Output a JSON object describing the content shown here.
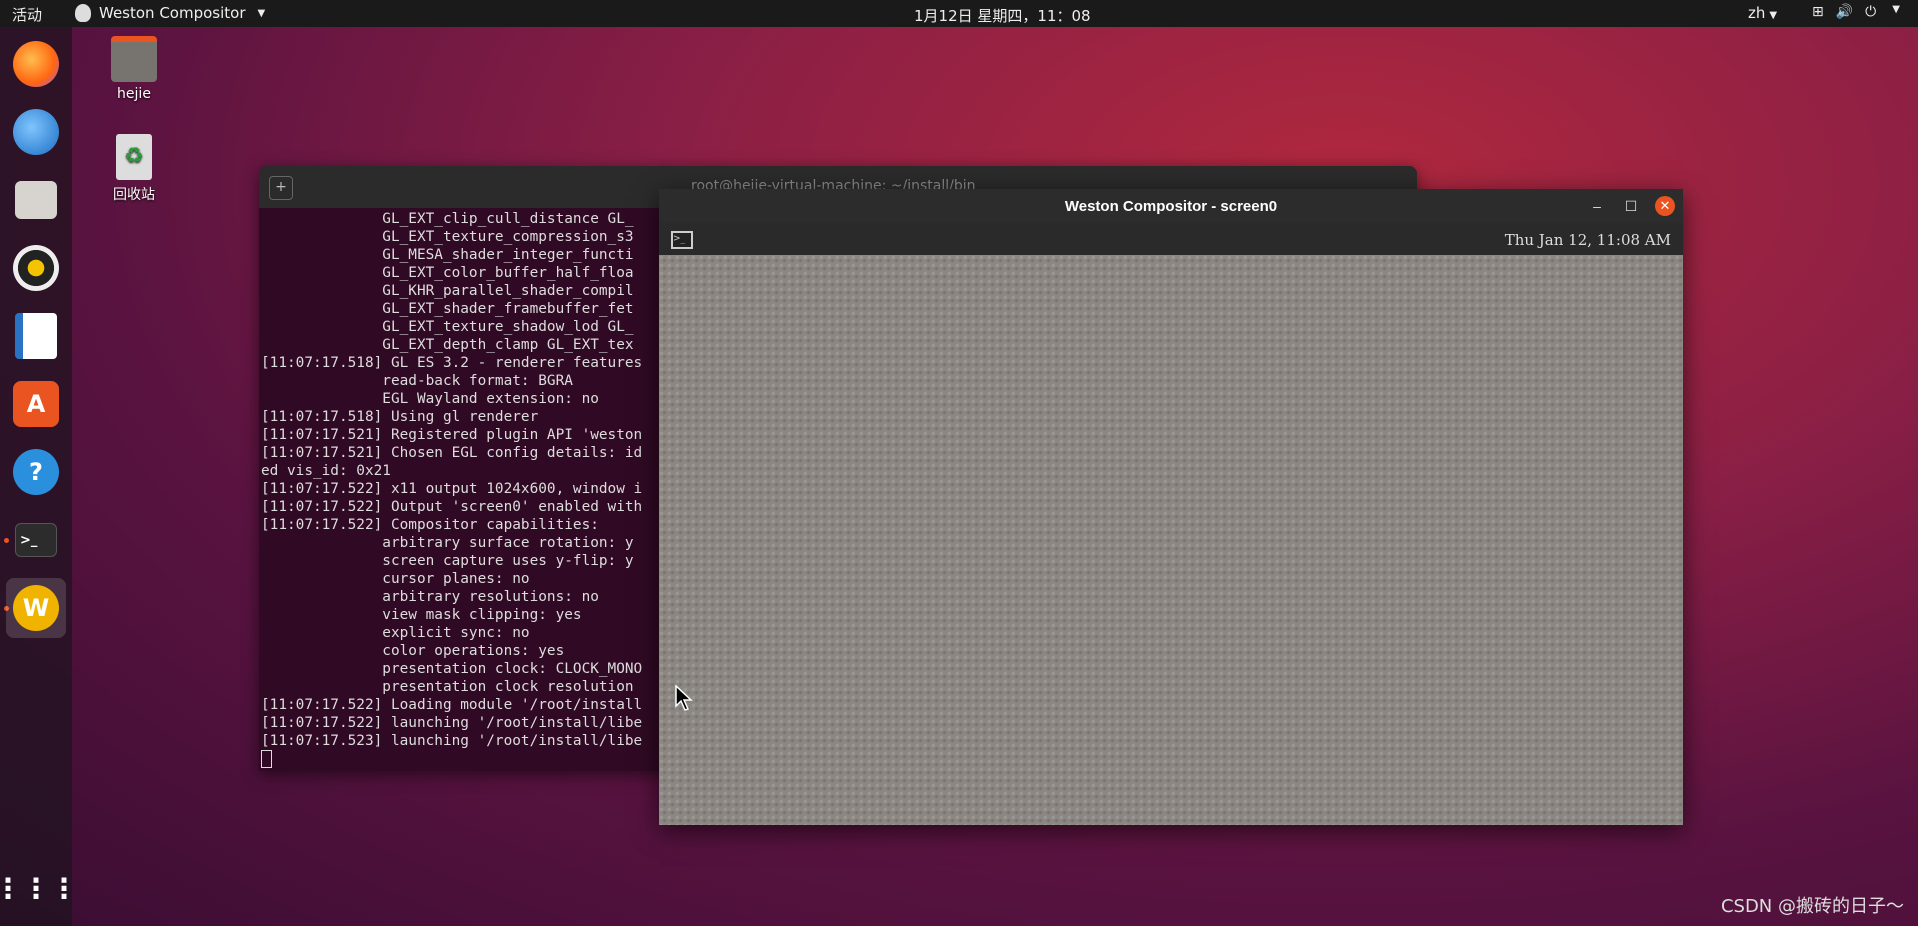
{
  "topbar": {
    "activities": "活动",
    "app_name": "Weston Compositor",
    "clock": "1月12日 星期四，11：08",
    "lang": "zh"
  },
  "desktop": {
    "home_label": "hejie",
    "trash_label": "回收站"
  },
  "terminal": {
    "title": "root@hejie-virtual-machine: ~/install/bin",
    "lines": [
      "              GL_EXT_clip_cull_distance GL_",
      "              GL_EXT_texture_compression_s3",
      "              GL_MESA_shader_integer_functi",
      "              GL_EXT_color_buffer_half_floa",
      "              GL_KHR_parallel_shader_compil",
      "              GL_EXT_shader_framebuffer_fet",
      "              GL_EXT_texture_shadow_lod GL_",
      "              GL_EXT_depth_clamp GL_EXT_tex",
      "[11:07:17.518] GL ES 3.2 - renderer features",
      "              read-back format: BGRA",
      "              EGL Wayland extension: no",
      "[11:07:17.518] Using gl renderer",
      "[11:07:17.521] Registered plugin API 'weston",
      "[11:07:17.521] Chosen EGL config details: id",
      "ed vis_id: 0x21",
      "[11:07:17.522] x11 output 1024x600, window i",
      "[11:07:17.522] Output 'screen0' enabled with",
      "[11:07:17.522] Compositor capabilities:",
      "              arbitrary surface rotation: y",
      "              screen capture uses y-flip: y",
      "              cursor planes: no",
      "              arbitrary resolutions: no",
      "              view mask clipping: yes",
      "              explicit sync: no",
      "              color operations: yes",
      "              presentation clock: CLOCK_MONO",
      "              presentation clock resolution",
      "[11:07:17.522] Loading module '/root/install",
      "[11:07:17.522] launching '/root/install/libe",
      "[11:07:17.523] launching '/root/install/libe"
    ]
  },
  "weston": {
    "title": "Weston Compositor - screen0",
    "clock": "Thu Jan 12, 11:08 AM"
  },
  "watermark": "CSDN @搬砖的日子～",
  "icons": {
    "minimize": "–",
    "maximize": "☐",
    "close": "✕"
  }
}
